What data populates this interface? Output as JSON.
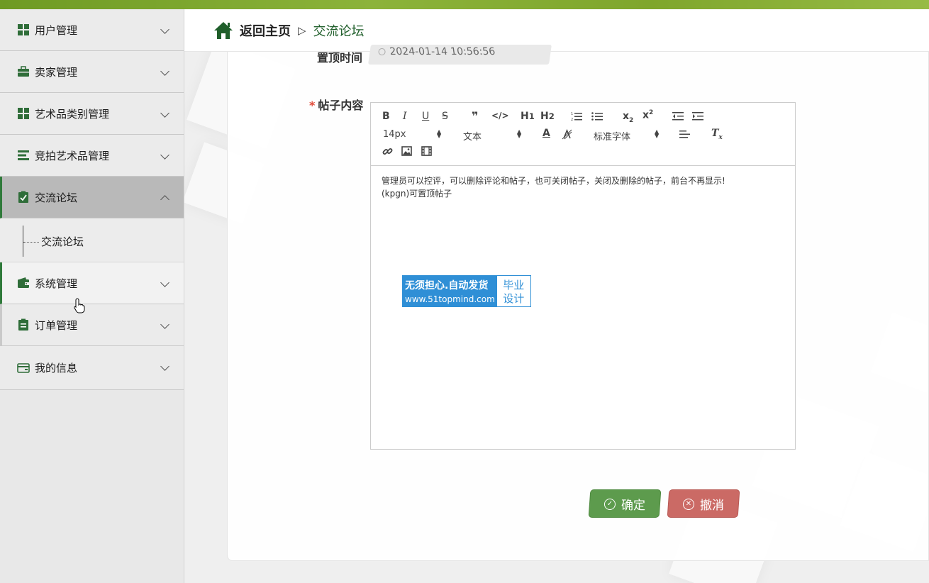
{
  "sidebar": {
    "items": [
      {
        "label": "用户管理",
        "icon": "grid-icon"
      },
      {
        "label": "卖家管理",
        "icon": "briefcase-icon"
      },
      {
        "label": "艺术品类别管理",
        "icon": "grid-icon"
      },
      {
        "label": "竞拍艺术品管理",
        "icon": "list-icon"
      },
      {
        "label": "交流论坛",
        "icon": "clipboard-check-icon"
      },
      {
        "label": "系统管理",
        "icon": "wallet-icon"
      },
      {
        "label": "订单管理",
        "icon": "clipboard-icon"
      },
      {
        "label": "我的信息",
        "icon": "card-icon"
      }
    ],
    "submenu": {
      "label": "交流论坛"
    }
  },
  "header": {
    "home": "返回主页",
    "separator": "▷",
    "current": "交流论坛"
  },
  "form": {
    "top_label": "置顶时间",
    "top_value": "2024-01-14 10:56:56",
    "content_label": "帖子内容",
    "required_mark": "*",
    "toolbar": {
      "font_size": "14px",
      "text_style": "文本",
      "font_family": "标准字体"
    },
    "content_line1": "管理员可以控评，可以删除评论和帖子，也可关闭帖子，关闭及删除的帖子，前台不再显示!",
    "content_line2": "(kpgn)可置顶帖子"
  },
  "watermark": {
    "line1": "无须担心.自动发货",
    "line2": "www.51topmind.com",
    "right1": "毕业",
    "right2": "设计"
  },
  "buttons": {
    "ok": "确定",
    "cancel": "撤消"
  },
  "colors": {
    "accent_green": "#2f7a3a",
    "ok_button": "#5d9b4d",
    "cancel_button": "#cb6a65"
  }
}
